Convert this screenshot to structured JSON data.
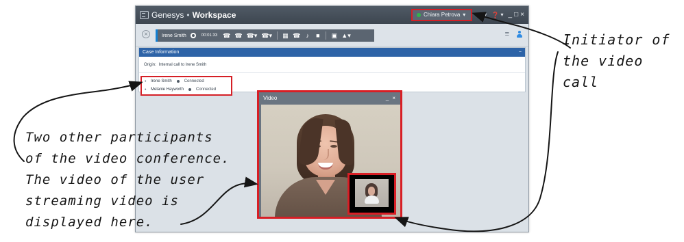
{
  "app": {
    "brand_name": "Genesys",
    "separator": "•",
    "product_name": "Workspace",
    "user_name": "Chiara Petrova"
  },
  "toolbar": {
    "active_interaction_name": "Irene Smith",
    "timer": "00:01:33"
  },
  "case_information": {
    "title": "Case Information",
    "origin_label": "Origin:",
    "origin_value": "Internal call to Irene Smith"
  },
  "participants": [
    {
      "name": "Irene Smith",
      "status": "Connected"
    },
    {
      "name": "Melanie Hayworth",
      "status": "Connected"
    }
  ],
  "video_window": {
    "title": "Video"
  },
  "annotations": {
    "initiator": "Initiator of\nthe video call",
    "participants_note": "Two other participants\nof the video conference.\nThe video of the user\nstreaming video is\ndisplayed here."
  },
  "icons": {
    "brand": "workspace-logo-icon",
    "user_status": "available-status-icon",
    "close": "close-circle-icon",
    "call_state": "call-state-icon",
    "phone": "phone-icon",
    "transfer": "transfer-icon",
    "conference": "conference-icon",
    "keypad": "keypad-icon",
    "mute": "mute-icon",
    "video": "video-camera-icon",
    "note": "note-icon",
    "consult": "consult-icon",
    "menu": "hamburger-menu-icon",
    "user": "user-icon",
    "minimize": "minimize-icon",
    "maximize": "maximize-icon",
    "window_close": "window-close-icon",
    "help": "help-icon",
    "settings": "settings-icon"
  },
  "colors": {
    "highlight_red": "#d51f26",
    "case_blue": "#2d63a7",
    "call_accent": "#1380d3",
    "status_green": "#35b24a"
  }
}
